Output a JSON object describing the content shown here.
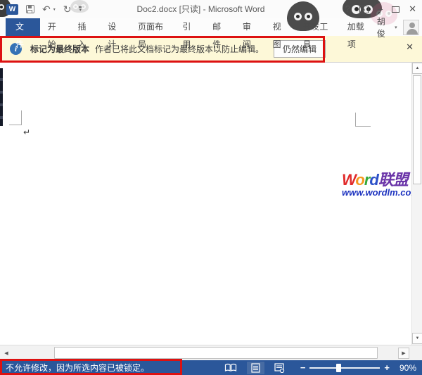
{
  "window": {
    "title": "Doc2.docx [只读] - Microsoft Word"
  },
  "qat": {
    "logo": "W",
    "undo": "↶",
    "undo_caret": "▾",
    "redo": "↻",
    "customize_caret": "▾"
  },
  "win_controls": {
    "help": "?",
    "ribbon_options": "▴",
    "minimize": "–",
    "close": "✕"
  },
  "ribbon": {
    "tabs": [
      {
        "label": "文件",
        "active": true
      },
      {
        "label": "开始",
        "active": false
      },
      {
        "label": "插入",
        "active": false
      },
      {
        "label": "设计",
        "active": false
      },
      {
        "label": "页面布局",
        "active": false
      },
      {
        "label": "引用",
        "active": false
      },
      {
        "label": "邮件",
        "active": false
      },
      {
        "label": "审阅",
        "active": false
      },
      {
        "label": "视图",
        "active": false
      },
      {
        "label": "开发工具",
        "active": false
      },
      {
        "label": "加载项",
        "active": false
      }
    ],
    "account": {
      "name": "胡俊",
      "caret": "▾"
    }
  },
  "message_bar": {
    "info_glyph": "i",
    "title": "标记为最终版本",
    "message": "作者已将此文档标记为最终版本以防止编辑。",
    "edit_button": "仍然编辑",
    "close": "✕"
  },
  "document": {
    "paragraph_mark": "↵"
  },
  "watermark": {
    "brand": [
      {
        "text": "W",
        "color": "#e12b2b"
      },
      {
        "text": "o",
        "color": "#f59a1f"
      },
      {
        "text": "r",
        "color": "#35a93c"
      },
      {
        "text": "d",
        "color": "#2b50c8"
      },
      {
        "text": "联盟",
        "color": "#6a34a8"
      }
    ],
    "url": "www.wordlm.com",
    "url_color": "#1f35c0"
  },
  "scrollbars": {
    "up": "▲",
    "down": "▼",
    "left": "◀",
    "right": "▶"
  },
  "status_bar": {
    "message": "不允许修改，因为所选内容已被锁定。",
    "zoom_out": "−",
    "zoom_in": "+",
    "zoom_level": "90%"
  },
  "colors": {
    "accent": "#2b579a",
    "message_bg": "#fdf8d8",
    "annotation_red": "#dd1111"
  }
}
